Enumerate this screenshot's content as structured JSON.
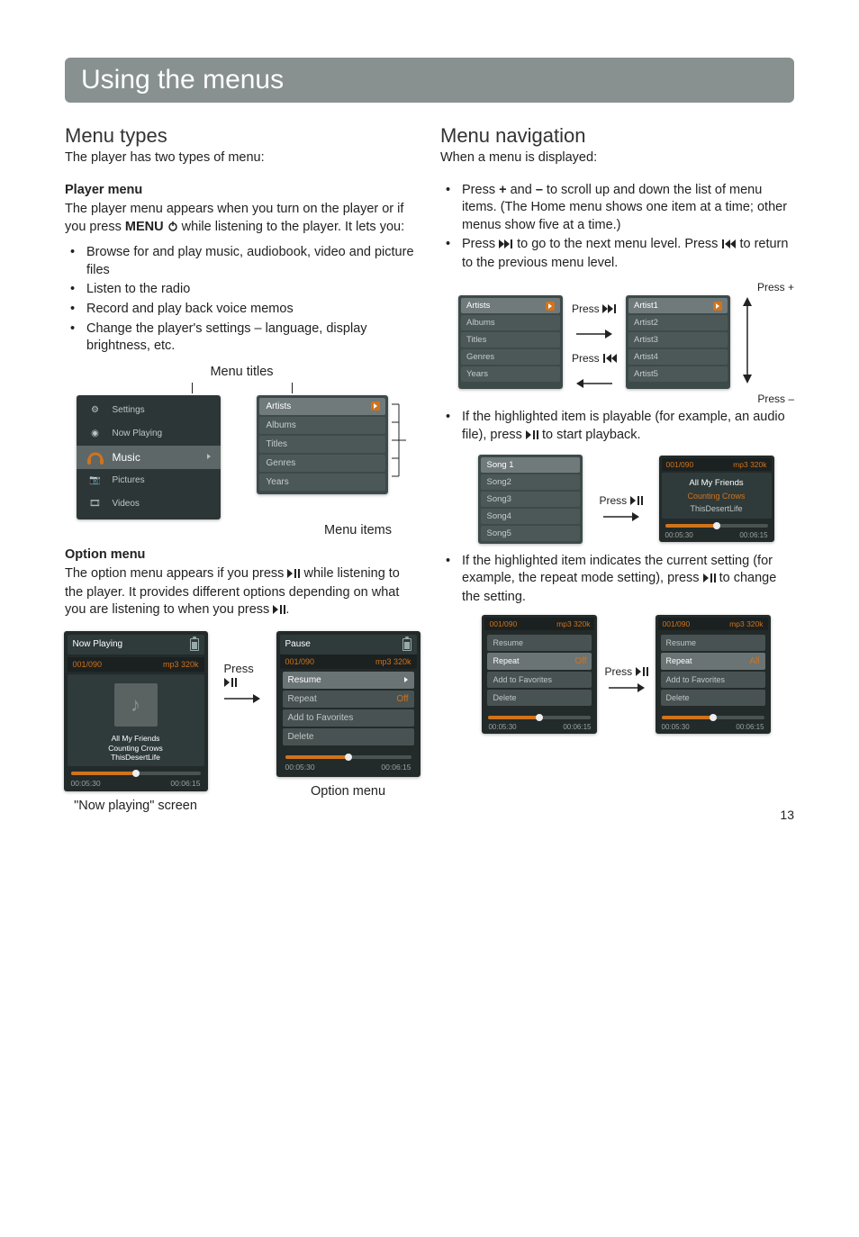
{
  "page_title": "Using the menus",
  "page_number": "13",
  "left": {
    "h": "Menu types",
    "lead": "The player has two types of menu:",
    "player_heading": "Player menu",
    "player_p1a": "The player menu appears when you turn on the player or if you press ",
    "player_p1b": "MENU",
    "player_p1c": " while listening to the player. It lets you:",
    "bullets": [
      "Browse for and play music, audiobook, video and picture files",
      "Listen to the radio",
      "Record and play back voice memos",
      "Change the player's settings – language, display brightness, etc."
    ],
    "fig1": {
      "titles_label": "Menu titles",
      "items_label": "Menu items",
      "home": [
        "Settings",
        "Now Playing",
        "Music",
        "Pictures",
        "Videos"
      ],
      "music": [
        "Artists",
        "Albums",
        "Titles",
        "Genres",
        "Years"
      ]
    },
    "option_heading": "Option menu",
    "option_p_a": "The option menu appears if you press ",
    "option_p_b": " while listening to the player. It provides different options depending on what you are listening to when you press ",
    "option_p_c": ".",
    "fig2": {
      "np_title": "Now Playing",
      "counter": "001/090",
      "codec": "mp3 320k",
      "tracks": [
        "All My Friends",
        "Counting Crows",
        "ThisDesertLife"
      ],
      "elapsed": "00:05:30",
      "total": "00:06:15",
      "np_caption": "\"Now playing\" screen",
      "press": "Press",
      "opt_title": "Pause",
      "opt_items": {
        "resume": "Resume",
        "repeat": "Repeat",
        "repeat_val": "Off",
        "add": "Add to Favorites",
        "delete": "Delete"
      },
      "opt_caption": "Option menu"
    }
  },
  "right": {
    "h": "Menu navigation",
    "lead": "When a menu is displayed:",
    "b1a": "Press ",
    "b1b": " and ",
    "b1c": " to scroll up and down the list of menu items. (The Home menu shows one item at a time; other menus show five at a time.)",
    "plus": "+",
    "minus": "–",
    "b2a": "Press ",
    "b2b": " to go to the next menu level. Press ",
    "b2c": " to return to the previous menu level.",
    "fig3": {
      "press_plus": "Press +",
      "press_minus": "Press –",
      "press_next": "Press",
      "press_prev": "Press",
      "left": [
        "Artists",
        "Albums",
        "Titles",
        "Genres",
        "Years"
      ],
      "right": [
        "Artist1",
        "Artist2",
        "Artist3",
        "Artist4",
        "Artist5"
      ]
    },
    "b3a": "If the highlighted item is playable (for example, an audio file), press ",
    "b3b": " to start playback.",
    "fig4": {
      "songs": [
        "Song 1",
        "Song2",
        "Song3",
        "Song4",
        "Song5"
      ],
      "press": "Press",
      "counter": "001/090",
      "codec": "mp3 320k",
      "t1": "All My Friends",
      "t2": "Counting Crows",
      "t3": "ThisDesertLife",
      "elapsed": "00:05:30",
      "total": "00:06:15"
    },
    "b4a": "If the highlighted item indicates the current setting (for example, the repeat mode setting), press ",
    "b4b": " to change the setting.",
    "fig5": {
      "counter": "001/090",
      "codec": "mp3 320k",
      "items": {
        "resume": "Resume",
        "repeat": "Repeat",
        "add": "Add to Favorites",
        "delete": "Delete"
      },
      "val_off": "Off",
      "val_all": "All",
      "press": "Press",
      "elapsed": "00:05:30",
      "total": "00:06:15"
    }
  }
}
